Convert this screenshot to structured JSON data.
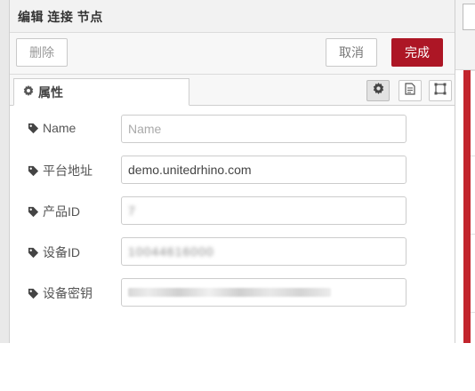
{
  "tray": {
    "title": "编辑 连接 节点",
    "buttons": {
      "delete": "删除",
      "cancel": "取消",
      "done": "完成"
    },
    "tab": {
      "label": "属性"
    }
  },
  "form": {
    "fields": [
      {
        "label": "Name",
        "value": "",
        "placeholder": "Name"
      },
      {
        "label": "平台地址",
        "value": "demo.unitedrhino.com"
      },
      {
        "label": "产品ID",
        "value": "7"
      },
      {
        "label": "设备ID",
        "value": "10044616000"
      },
      {
        "label": "设备密钥",
        "value": ""
      }
    ]
  },
  "colors": {
    "accent": "#ad1625",
    "canvas_strip": "#c2252d"
  },
  "icons": [
    "gear-icon",
    "tag-icon",
    "document-icon",
    "frame-icon"
  ]
}
